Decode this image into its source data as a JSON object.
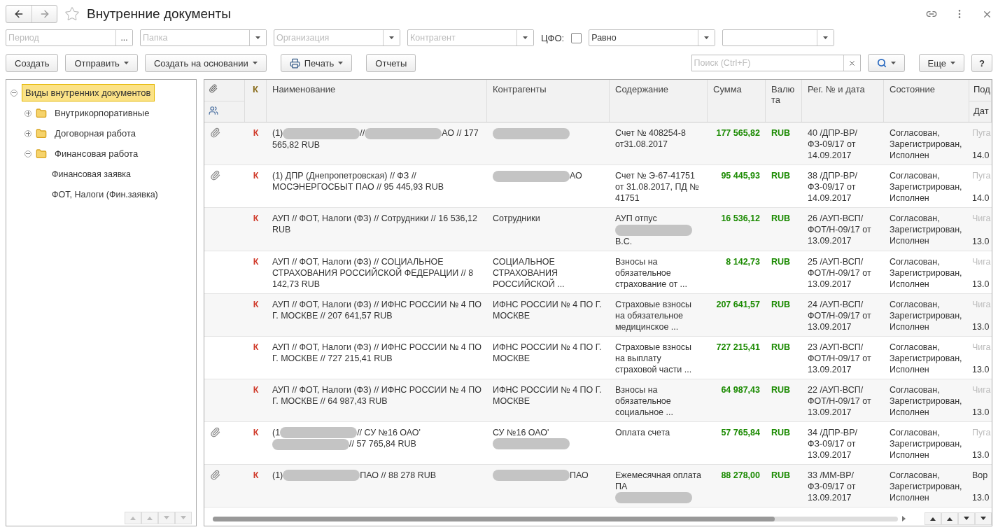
{
  "window": {
    "title": "Внутренние документы",
    "favorite": false
  },
  "filters": {
    "period": {
      "placeholder": "Период",
      "button": "..."
    },
    "dropdowns": [
      {
        "placeholder": "Папка"
      },
      {
        "placeholder": "Организация"
      },
      {
        "placeholder": "Контрагент"
      }
    ],
    "cfo": {
      "label": "ЦФО:",
      "checked": false
    },
    "condition": {
      "value": "Равно"
    }
  },
  "toolbar": {
    "buttons": [
      {
        "label": "Создать",
        "menu": false,
        "kind": "plain"
      },
      {
        "label": "Отправить",
        "menu": true,
        "kind": "plain"
      },
      {
        "label": "Создать на основании",
        "menu": true,
        "kind": "plain"
      },
      {
        "label": "Печать",
        "menu": true,
        "kind": "print"
      },
      {
        "label": "Отчеты",
        "menu": false,
        "kind": "plain"
      }
    ],
    "search": {
      "placeholder": "Поиск (Ctrl+F)"
    },
    "more": "Еще",
    "help": "?"
  },
  "tree": {
    "label": "Виды внутренних документов",
    "selected": true,
    "expanded": true,
    "children": [
      {
        "label": "Внутрикорпоративные",
        "selected": false,
        "expanded": false,
        "kind": "folder"
      },
      {
        "label": "Договорная работа",
        "selected": false,
        "expanded": false,
        "kind": "folder"
      },
      {
        "label": "Финансовая работа",
        "selected": false,
        "expanded": true,
        "kind": "folder",
        "children": [
          {
            "label": "Финансовая заявка",
            "selected": false,
            "kind": "item"
          },
          {
            "label": "ФОТ, Налоги (Фин.заявка)",
            "selected": false,
            "kind": "item"
          }
        ]
      }
    ]
  },
  "table": {
    "columns": [
      "К",
      "Наименование",
      "Контрагенты",
      "Содержание",
      "Сумма",
      "Валюта",
      "Рег. № и дата",
      "Состояние",
      "Под"
    ],
    "subcolumn": "Дат",
    "rows": [
      {
        "attachment": true,
        "mark": "К",
        "name": [
          {
            "kind": "text",
            "text": "(1)"
          },
          {
            "kind": "redaction"
          },
          {
            "kind": "text",
            "text": "//"
          },
          {
            "kind": "redaction"
          },
          {
            "kind": "text",
            "text": "АО // 177 565,82 RUB"
          }
        ],
        "counterparty": [
          {
            "kind": "redaction"
          }
        ],
        "content": [
          {
            "kind": "text",
            "text": "Счет № 408254-8 от31.08.2017"
          }
        ],
        "sum": "177 565,82",
        "currency": "RUB",
        "reg": "40 /ДПР-ВР/ ФЗ-09/17 от 14.09.2017",
        "status": "Согласован, Зарегистрирован, Исполнен",
        "author": "Пуга",
        "author_muted": true,
        "date": "14.0"
      },
      {
        "attachment": true,
        "mark": "К",
        "name": [
          {
            "kind": "text",
            "text": "(1) ДПР (Днепропетровская) // ФЗ // МОСЭНЕРГОСБЫТ ПАО // 95 445,93 RUB"
          }
        ],
        "counterparty": [
          {
            "kind": "redaction"
          },
          {
            "kind": "text",
            "text": "АО"
          }
        ],
        "content": [
          {
            "kind": "text",
            "text": "Счет № Э-67-41751 от 31.08.2017, ПД № 41751"
          }
        ],
        "sum": "95 445,93",
        "currency": "RUB",
        "reg": "38 /ДПР-ВР/ ФЗ-09/17 от 14.09.2017",
        "status": "Согласован, Зарегистрирован, Исполнен",
        "author": "Пуга",
        "author_muted": true,
        "date": "14.0"
      },
      {
        "attachment": false,
        "mark": "К",
        "name": [
          {
            "kind": "text",
            "text": "АУП // ФОТ, Налоги (ФЗ) // Сотрудники // 16 536,12 RUB"
          }
        ],
        "counterparty": [
          {
            "kind": "text",
            "text": "Сотрудники"
          }
        ],
        "content": [
          {
            "kind": "text",
            "text": "АУП отпус"
          },
          {
            "kind": "redaction"
          },
          {
            "kind": "text",
            "text": "В.С."
          }
        ],
        "sum": "16 536,12",
        "currency": "RUB",
        "reg": "26 /АУП-ВСП/ ФОТ/Н-09/17 от 13.09.2017",
        "status": "Согласован, Зарегистрирован, Исполнен",
        "author": "Чига",
        "author_muted": true,
        "date": "13.0"
      },
      {
        "attachment": false,
        "mark": "К",
        "name": [
          {
            "kind": "text",
            "text": "АУП // ФОТ, Налоги (ФЗ) //  СОЦИАЛЬНОЕ СТРАХОВАНИЯ РОССИЙСКОЙ ФЕДЕРАЦИИ // 8 142,73 RUB"
          }
        ],
        "counterparty": [
          {
            "kind": "text",
            "text": "СОЦИАЛЬНОЕ СТРАХОВАНИЯ РОССИЙСКОЙ ..."
          }
        ],
        "content": [
          {
            "kind": "text",
            "text": "Взносы на обязательное страхование от ..."
          }
        ],
        "sum": "8 142,73",
        "currency": "RUB",
        "reg": "25 /АУП-ВСП/ ФОТ/Н-09/17 от 13.09.2017",
        "status": "Согласован, Зарегистрирован, Исполнен",
        "author": "Чига",
        "author_muted": true,
        "date": "13.0"
      },
      {
        "attachment": false,
        "mark": "К",
        "name": [
          {
            "kind": "text",
            "text": "АУП // ФОТ, Налоги (ФЗ) // ИФНС РОССИИ № 4 ПО Г. МОСКВЕ // 207 641,57 RUB"
          }
        ],
        "counterparty": [
          {
            "kind": "text",
            "text": "ИФНС РОССИИ № 4 ПО Г. МОСКВЕ"
          }
        ],
        "content": [
          {
            "kind": "text",
            "text": "Страховые взносы на обязательное медицинское ..."
          }
        ],
        "sum": "207 641,57",
        "currency": "RUB",
        "reg": "24 /АУП-ВСП/ ФОТ/Н-09/17 от 13.09.2017",
        "status": "Согласован, Зарегистрирован, Исполнен",
        "author": "Чига",
        "author_muted": true,
        "date": "13.0"
      },
      {
        "attachment": false,
        "mark": "К",
        "name": [
          {
            "kind": "text",
            "text": "АУП // ФОТ, Налоги (ФЗ) // ИФНС РОССИИ № 4 ПО Г. МОСКВЕ // 727 215,41 RUB"
          }
        ],
        "counterparty": [
          {
            "kind": "text",
            "text": "ИФНС РОССИИ № 4 ПО Г. МОСКВЕ"
          }
        ],
        "content": [
          {
            "kind": "text",
            "text": "Страховые взносы на выплату страховой части ..."
          }
        ],
        "sum": "727 215,41",
        "currency": "RUB",
        "reg": "23 /АУП-ВСП/ ФОТ/Н-09/17 от 13.09.2017",
        "status": "Согласован, Зарегистрирован, Исполнен",
        "author": "Чига",
        "author_muted": true,
        "date": "13.0"
      },
      {
        "attachment": false,
        "mark": "К",
        "name": [
          {
            "kind": "text",
            "text": "АУП // ФОТ, Налоги (ФЗ) // ИФНС РОССИИ № 4 ПО Г. МОСКВЕ // 64 987,43 RUB"
          }
        ],
        "counterparty": [
          {
            "kind": "text",
            "text": "ИФНС РОССИИ № 4 ПО Г. МОСКВЕ"
          }
        ],
        "content": [
          {
            "kind": "text",
            "text": "Взносы на обязательное социальное ..."
          }
        ],
        "sum": "64 987,43",
        "currency": "RUB",
        "reg": "22 /АУП-ВСП/ ФОТ/Н-09/17 от 13.09.2017",
        "status": "Согласован, Зарегистрирован, Исполнен",
        "author": "Чига",
        "author_muted": true,
        "date": "13.0"
      },
      {
        "attachment": true,
        "mark": "К",
        "name": [
          {
            "kind": "text",
            "text": "(1"
          },
          {
            "kind": "redaction"
          },
          {
            "kind": "text",
            "text": "// СУ №16 ОАО'"
          },
          {
            "kind": "redaction"
          },
          {
            "kind": "text",
            "text": "// 57 765,84 RUB"
          }
        ],
        "counterparty": [
          {
            "kind": "text",
            "text": "СУ №16 ОАО'"
          },
          {
            "kind": "redaction"
          }
        ],
        "content": [
          {
            "kind": "text",
            "text": "Оплата счета"
          }
        ],
        "sum": "57 765,84",
        "currency": "RUB",
        "reg": "34 /ДПР-ВР/ ФЗ-09/17 от 13.09.2017",
        "status": "Согласован, Зарегистрирован, Исполнен",
        "author": "Пуга",
        "author_muted": true,
        "date": "13.0"
      },
      {
        "attachment": true,
        "mark": "К",
        "name": [
          {
            "kind": "text",
            "text": "(1)"
          },
          {
            "kind": "redaction"
          },
          {
            "kind": "text",
            "text": "ПАО // 88 278 RUB"
          }
        ],
        "counterparty": [
          {
            "kind": "redaction"
          },
          {
            "kind": "text",
            "text": "ПАО"
          }
        ],
        "content": [
          {
            "kind": "text",
            "text": "Ежемесячная оплата ПА"
          },
          {
            "kind": "redaction"
          }
        ],
        "sum": "88 278,00",
        "currency": "RUB",
        "reg": "33 /ММ-ВР/ ФЗ-09/17 от 13.09.2017",
        "status": "Согласован, Зарегистрирован, Исполнен",
        "author": "Вор",
        "author_muted": false,
        "date": "13.0"
      }
    ]
  }
}
